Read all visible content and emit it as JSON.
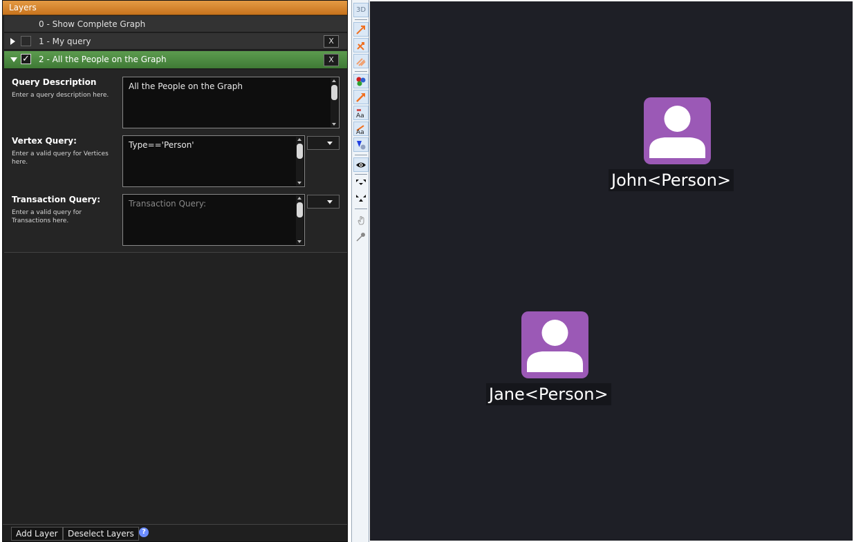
{
  "layers_panel": {
    "title": "Layers",
    "layers": [
      {
        "index": "0",
        "label": "0  - Show Complete Graph"
      },
      {
        "index": "1",
        "label": "1  - My query",
        "close": "X"
      },
      {
        "index": "2",
        "label": "2  - All the People on the Graph",
        "close": "X"
      }
    ],
    "detail": {
      "query_description": {
        "title": "Query Description",
        "help": "Enter a query description here.",
        "value": "All the People on the Graph"
      },
      "vertex_query": {
        "title": "Vertex Query:",
        "help": "Enter a valid query for Vertices here.",
        "value": "Type=='Person'"
      },
      "transaction_query": {
        "title": "Transaction Query:",
        "help": "Enter a valid query for Transactions here.",
        "placeholder": "Transaction Query:"
      }
    },
    "footer": {
      "add_layer": "Add Layer",
      "deselect_layers": "Deselect Layers",
      "help": "?"
    }
  },
  "toolbar": {
    "mode_3d": "3D"
  },
  "graph": {
    "nodes": [
      {
        "label": "John<Person>",
        "icon": "person-icon",
        "color": "#9b59b6"
      },
      {
        "label": "Jane<Person>",
        "icon": "person-icon",
        "color": "#9b59b6"
      }
    ]
  }
}
